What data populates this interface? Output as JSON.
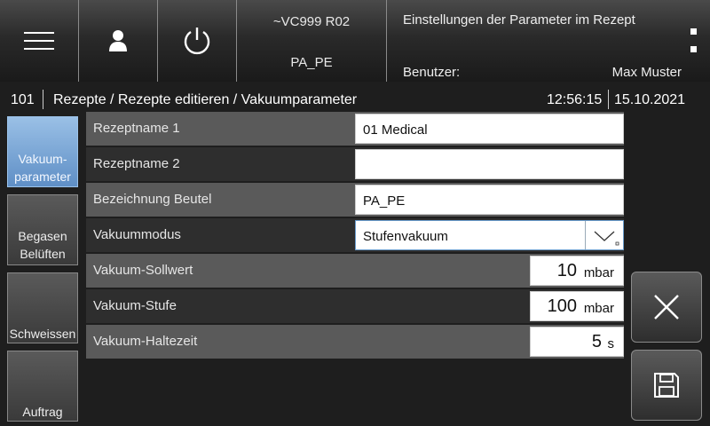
{
  "header": {
    "menu_icon": "hamburger-icon",
    "user_icon": "user-icon",
    "power_icon": "power-icon",
    "device_id": "~VC999 R02",
    "device_label": "PA_PE",
    "title": "Einstellungen der Parameter im Rezept",
    "user_label": "Benutzer:",
    "user_name": "Max Muster"
  },
  "breadcrumb": {
    "number": "101",
    "path": "Rezepte / Rezepte editieren / Vakuumparameter",
    "time": "12:56:15",
    "date": "15.10.2021"
  },
  "nav": {
    "items": [
      {
        "label": "Vakuum-\nparameter",
        "active": true
      },
      {
        "label": "Begasen\nBelüften",
        "active": false
      },
      {
        "label": "Schweissen",
        "active": false
      },
      {
        "label": "Auftrag",
        "active": false
      }
    ]
  },
  "params": {
    "rezeptname1": {
      "label": "Rezeptname 1",
      "value": "01 Medical"
    },
    "rezeptname2": {
      "label": "Rezeptname 2",
      "value": ""
    },
    "beutel": {
      "label": "Bezeichnung Beutel",
      "value": "PA_PE"
    },
    "modus": {
      "label": "Vakuummodus",
      "value": "Stufenvakuum"
    },
    "sollwert": {
      "label": "Vakuum-Sollwert",
      "value": "10",
      "unit": "mbar"
    },
    "stufe": {
      "label": "Vakuum-Stufe",
      "value": "100",
      "unit": "mbar"
    },
    "haltezeit": {
      "label": "Vakuum-Haltezeit",
      "value": "5",
      "unit": "s"
    }
  },
  "actions": {
    "cancel_icon": "close-icon",
    "save_icon": "save-icon"
  },
  "colors": {
    "accent": "#6a9ccc",
    "active_nav": "#7aa6d6",
    "row_light": "#5a5a5a",
    "row_dark": "#2e2e2e"
  }
}
